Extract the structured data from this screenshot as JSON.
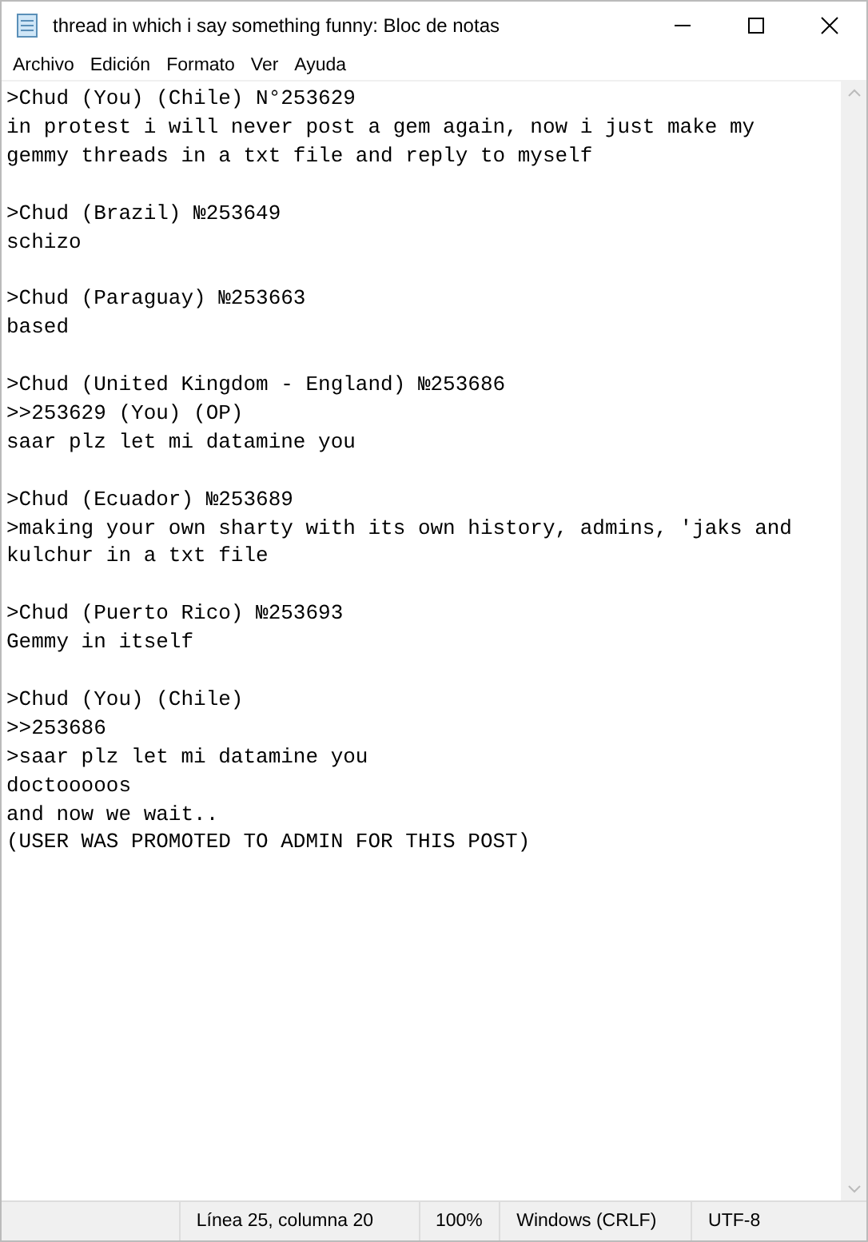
{
  "window": {
    "title": "thread in which i say something funny: Bloc de notas"
  },
  "menu": [
    "Archivo",
    "Edición",
    "Formato",
    "Ver",
    "Ayuda"
  ],
  "posts": [
    [
      ">Chud (You) (Chile) N°253629",
      "in protest i will never post a gem again, now i just make my gemmy threads in a txt file and reply to myself"
    ],
    [
      ">Chud (Brazil) №253649",
      "schizo"
    ],
    [
      ">Chud (Paraguay) №253663",
      "based"
    ],
    [
      ">Chud (United Kingdom - England) №253686",
      ">>253629 (You) (OP)",
      "saar plz let mi datamine you"
    ],
    [
      ">Chud (Ecuador) №253689",
      ">making your own sharty with its own history, admins, 'jaks and kulchur in a txt file"
    ],
    [
      ">Chud (Puerto Rico) №253693",
      "Gemmy in itself"
    ],
    [
      ">Chud (You) (Chile)",
      ">>253686",
      ">saar plz let mi datamine you",
      "doctooooos",
      "and now we wait..",
      "(USER WAS PROMOTED TO ADMIN FOR THIS POST)"
    ]
  ],
  "status_bar": {
    "position": "Línea 25, columna 20",
    "zoom": "100%",
    "line_endings": "Windows (CRLF)",
    "encoding": "UTF-8"
  }
}
